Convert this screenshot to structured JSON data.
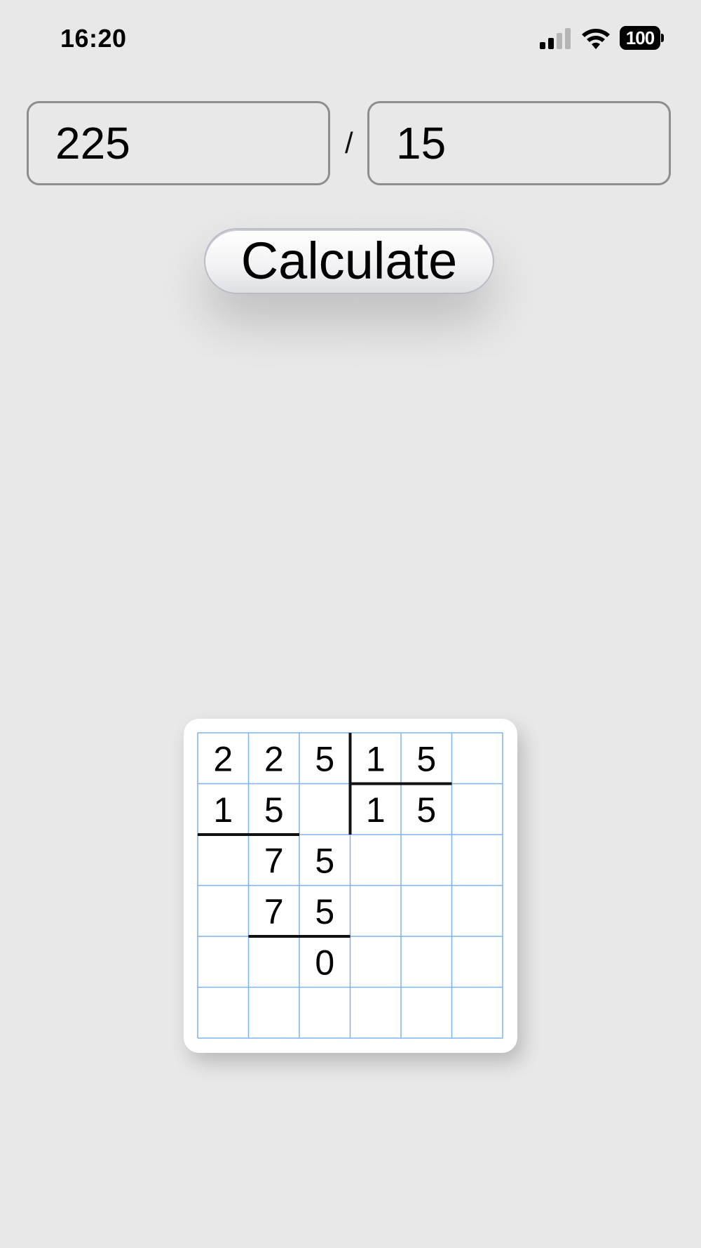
{
  "status_bar": {
    "time": "16:20",
    "battery": "100",
    "icons": [
      "signal-icon",
      "wifi-icon",
      "battery-icon"
    ]
  },
  "inputs": {
    "dividend": "225",
    "divisor": "15",
    "operator": "/"
  },
  "calculate_button": {
    "label": "Calculate"
  },
  "long_division": {
    "columns": 6,
    "rows": 6,
    "cells": [
      [
        "2",
        "2",
        "5",
        "1",
        "5",
        ""
      ],
      [
        "1",
        "5",
        "",
        "1",
        "5",
        ""
      ],
      [
        "",
        "7",
        "5",
        "",
        "",
        ""
      ],
      [
        "",
        "7",
        "5",
        "",
        "",
        ""
      ],
      [
        "",
        "",
        "0",
        "",
        "",
        ""
      ],
      [
        "",
        "",
        "",
        "",
        "",
        ""
      ]
    ],
    "colors": {
      "grid_line": "#7db3ec",
      "rule_line": "#111111",
      "digit": "#000000"
    }
  }
}
